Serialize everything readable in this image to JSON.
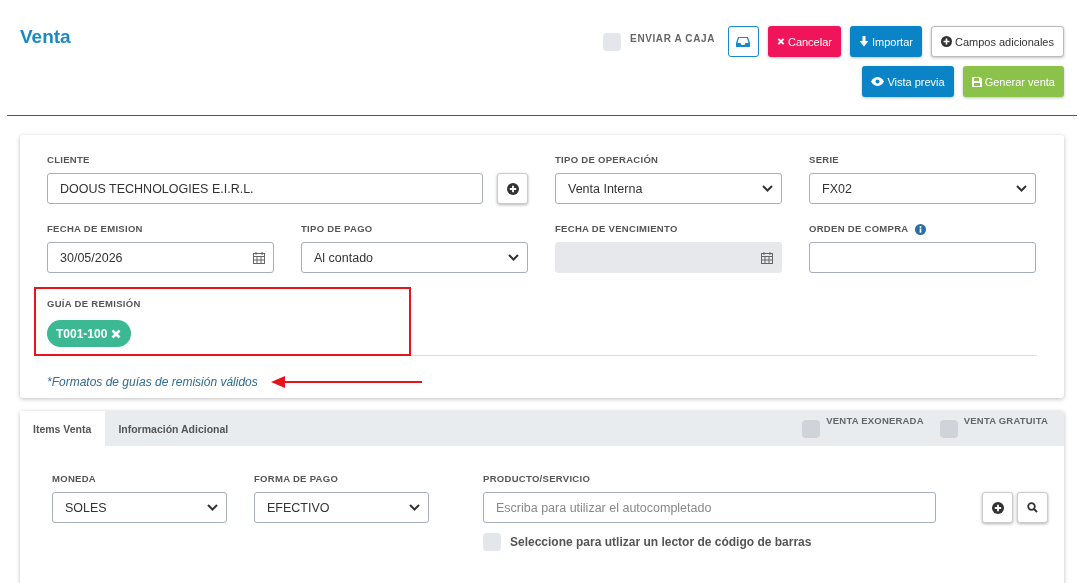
{
  "title": "Venta",
  "send_to_cash": {
    "label": "ENVIAR A CAJA",
    "checked": false
  },
  "header_buttons": [
    {
      "kind": "tray"
    },
    {
      "kind": "cancel",
      "label": "Cancelar"
    },
    {
      "kind": "import",
      "label": "Importar"
    },
    {
      "kind": "fields",
      "label": "Campos adicionales"
    }
  ],
  "header_buttons_2": [
    {
      "kind": "preview",
      "label": "Vista previa"
    },
    {
      "kind": "generate",
      "label": "Generar venta"
    }
  ],
  "form": {
    "fields": [
      {
        "kind": "client",
        "label": "CLIENTE",
        "value": "DOOUS TECHNOLOGIES E.I.R.L."
      },
      {
        "kind": "select",
        "label": "TIPO DE OPERACIÓN",
        "value": "Venta Interna"
      },
      {
        "kind": "select",
        "label": "SERIE",
        "value": "FX02"
      },
      {
        "kind": "date",
        "label": "FECHA DE EMISION",
        "value": "30/05/2026"
      },
      {
        "kind": "select",
        "label": "TIPO DE PAGO",
        "value": "Al contado"
      },
      {
        "kind": "date",
        "label": "FECHA DE VENCIMIENTO",
        "disabled": true
      },
      {
        "kind": "text",
        "label": "ORDEN DE COMPRA",
        "info": true
      },
      {
        "kind": "tags",
        "label": "GUÍA DE REMISIÓN",
        "tags": [
          "T001-100"
        ]
      }
    ],
    "note": "*Formatos de guías de remisión válidos"
  },
  "items": {
    "tabs": [
      {
        "label": "Items Venta",
        "selected": true
      },
      {
        "label": "Información Adicional",
        "selected": false
      }
    ],
    "checks": [
      {
        "label": "VENTA EXONERADA",
        "checked": false
      },
      {
        "label": "VENTA GRATUITA",
        "checked": false
      }
    ],
    "currency": {
      "label": "MONEDA",
      "value": "SOLES"
    },
    "payment": {
      "label": "FORMA DE PAGO",
      "value": "EFECTIVO"
    },
    "product": {
      "label": "PRODUCTO/SERVICIO",
      "placeholder": "Escriba para utilizar el autocompletado"
    },
    "barcode": {
      "label": "Seleccione para utlizar un lector de código de barras",
      "checked": false
    }
  }
}
